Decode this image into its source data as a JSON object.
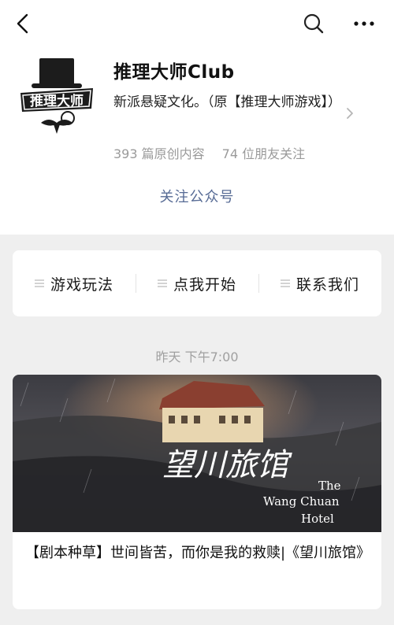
{
  "navbar": {
    "back_icon": "chevron-left-icon",
    "search_icon": "search-icon",
    "more_icon": "more-dots-icon"
  },
  "account": {
    "logo_text": "推理大师",
    "name": "推理大师Club",
    "description": "新派悬疑文化。（原【推理大师游戏】）",
    "original_count": "393 篇原创内容",
    "friends_follow": "74 位朋友关注",
    "follow_label": "关注公众号"
  },
  "menu": {
    "items": [
      {
        "label": "游戏玩法",
        "icon": "menu-lines-icon"
      },
      {
        "label": "点我开始",
        "icon": "menu-lines-icon"
      },
      {
        "label": "联系我们",
        "icon": "menu-lines-icon"
      }
    ]
  },
  "feed": {
    "timestamp": "昨天 下午7:00",
    "article": {
      "cover_title_cn": "望川旅馆",
      "cover_title_en_1": "The",
      "cover_title_en_2": "Wang Chuan",
      "cover_title_en_3": "Hotel",
      "title": "【剧本种草】世间皆苦，而你是我的救赎|《望川旅馆》"
    }
  },
  "colors": {
    "link": "#576b95",
    "muted": "#9a9a9a",
    "background": "#efefef"
  }
}
